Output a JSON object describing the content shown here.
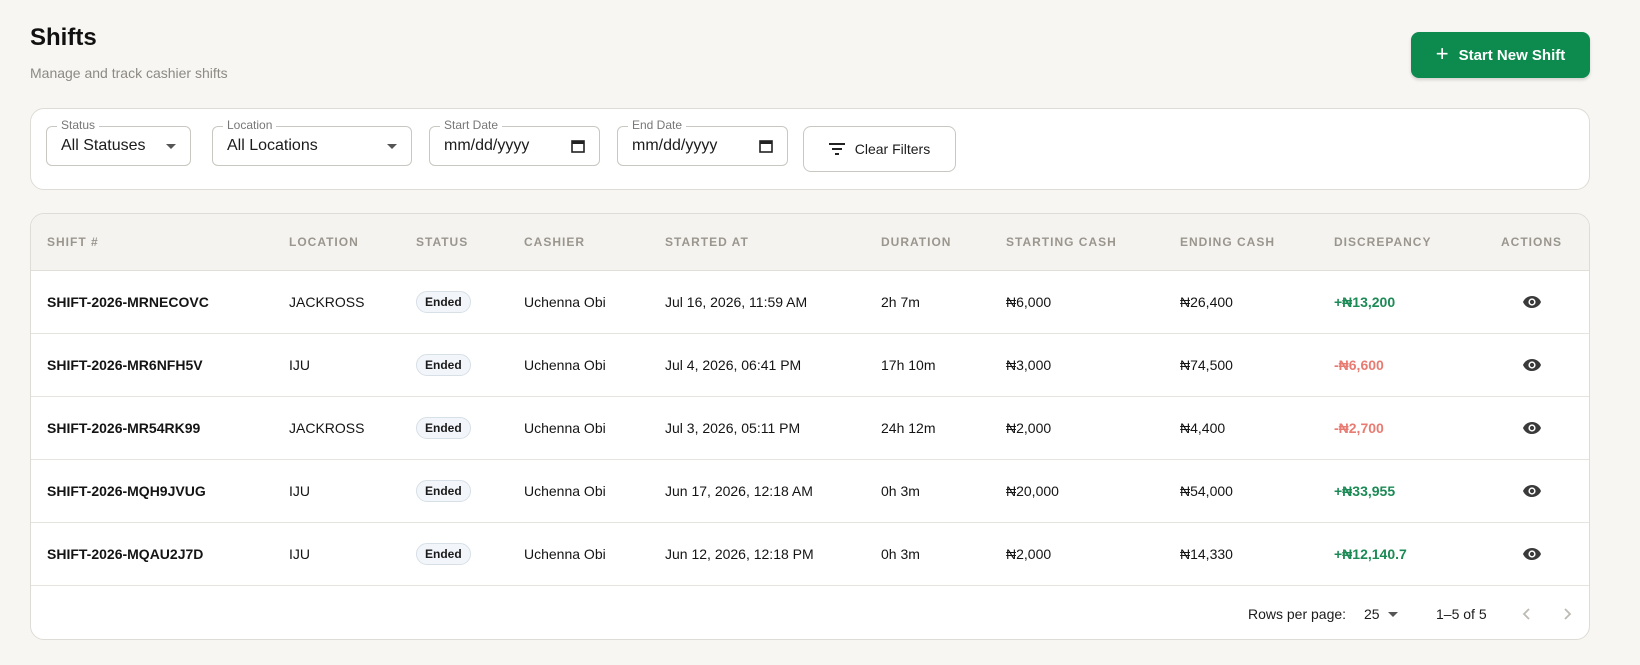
{
  "header": {
    "title": "Shifts",
    "subtitle": "Manage and track cashier shifts",
    "start_button_label": "Start New Shift",
    "start_button_icon": "plus-icon"
  },
  "filters": {
    "status": {
      "label": "Status",
      "value": "All Statuses"
    },
    "location": {
      "label": "Location",
      "value": "All Locations"
    },
    "start_date": {
      "label": "Start Date",
      "value": "mm/dd/yyyy"
    },
    "end_date": {
      "label": "End Date",
      "value": "mm/dd/yyyy"
    },
    "clear_label": "Clear Filters",
    "clear_icon": "filter-icon"
  },
  "table": {
    "columns": [
      "Shift #",
      "Location",
      "Status",
      "Cashier",
      "Started At",
      "Duration",
      "Starting Cash",
      "Ending Cash",
      "Discrepancy",
      "Actions"
    ],
    "rows": [
      {
        "shift": "SHIFT-2026-MRNECOVC",
        "location": "JACKROSS",
        "status": "Ended",
        "cashier": "Uchenna Obi",
        "started_at": "Jul 16, 2026, 11:59 AM",
        "duration": "2h 7m",
        "starting_cash": "₦6,000",
        "ending_cash": "₦26,400",
        "discrepancy": "+₦13,200",
        "discrepancy_sign": "positive"
      },
      {
        "shift": "SHIFT-2026-MR6NFH5V",
        "location": "IJU",
        "status": "Ended",
        "cashier": "Uchenna Obi",
        "started_at": "Jul 4, 2026, 06:41 PM",
        "duration": "17h 10m",
        "starting_cash": "₦3,000",
        "ending_cash": "₦74,500",
        "discrepancy": "-₦6,600",
        "discrepancy_sign": "negative"
      },
      {
        "shift": "SHIFT-2026-MR54RK99",
        "location": "JACKROSS",
        "status": "Ended",
        "cashier": "Uchenna Obi",
        "started_at": "Jul 3, 2026, 05:11 PM",
        "duration": "24h 12m",
        "starting_cash": "₦2,000",
        "ending_cash": "₦4,400",
        "discrepancy": "-₦2,700",
        "discrepancy_sign": "negative"
      },
      {
        "shift": "SHIFT-2026-MQH9JVUG",
        "location": "IJU",
        "status": "Ended",
        "cashier": "Uchenna Obi",
        "started_at": "Jun 17, 2026, 12:18 AM",
        "duration": "0h 3m",
        "starting_cash": "₦20,000",
        "ending_cash": "₦54,000",
        "discrepancy": "+₦33,955",
        "discrepancy_sign": "positive"
      },
      {
        "shift": "SHIFT-2026-MQAU2J7D",
        "location": "IJU",
        "status": "Ended",
        "cashier": "Uchenna Obi",
        "started_at": "Jun 12, 2026, 12:18 PM",
        "duration": "0h 3m",
        "starting_cash": "₦2,000",
        "ending_cash": "₦14,330",
        "discrepancy": "+₦12,140.7",
        "discrepancy_sign": "positive"
      }
    ],
    "action_icon": "eye-icon"
  },
  "pagination": {
    "rows_per_page_label": "Rows per page:",
    "rows_per_page_value": "25",
    "range_label": "1–5 of 5"
  },
  "colors": {
    "primary": "#0d8a4e",
    "positive": "#1b8a55",
    "negative": "#e87b72",
    "background": "#f7f6f2"
  }
}
